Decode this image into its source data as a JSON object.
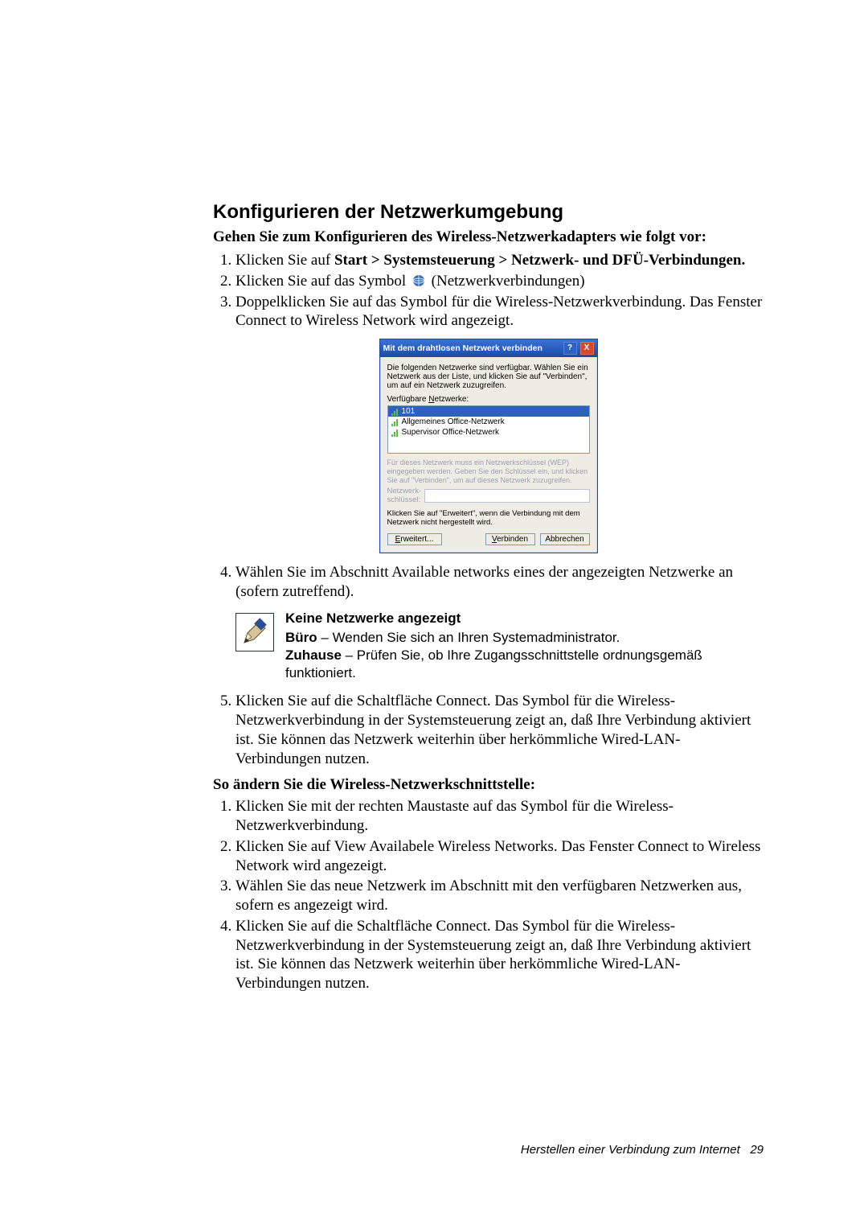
{
  "section_title": "Konfigurieren der Netzwerkumgebung",
  "intro_bold": "Gehen Sie zum Konfigurieren des Wireless-Netzwerkadapters wie folgt vor:",
  "stepsA": {
    "s1_pre": "Klicken Sie auf ",
    "s1_bold": "Start > Systemsteuerung > Netzwerk- und DFÜ-Verbindungen.",
    "s2_pre": "Klicken Sie auf das Symbol ",
    "s2_post": " (Netzwerkverbindungen)",
    "s3": "Doppelklicken Sie auf das Symbol für die Wireless-Netzwerkverbindung. Das Fenster Connect to Wireless Network wird angezeigt.",
    "s4": "Wählen Sie im Abschnitt Available networks eines der angezeigten Netzwerke an (sofern zutreffend).",
    "s5": "Klicken Sie auf die Schaltfläche Connect. Das Symbol für die Wireless-Netzwerkverbindung in der Systemsteuerung zeigt an, daß Ihre Verbindung aktiviert ist. Sie können das Netzwerk weiterhin über herkömmliche Wired-LAN-Verbindungen nutzen."
  },
  "dialog": {
    "title": "Mit dem drahtlosen Netzwerk verbinden",
    "text1": "Die folgenden Netzwerke sind verfügbar. Wählen Sie ein Netzwerk aus der Liste, und klicken Sie auf \"Verbinden\", um auf ein Netzwerk zuzugreifen.",
    "label_pre": "Verfügbare ",
    "label_ul": "N",
    "label_post": "etzwerke:",
    "net1": "101",
    "net2": "Allgemeines Office-Netzwerk",
    "net3": "Supervisor Office-Netzwerk",
    "hint": "Für dieses Netzwerk muss ein Netzwerkschlüssel (WEP) eingegeben werden. Geben Sie den Schlüssel ein, und klicken Sie auf \"Verbinden\", um auf dieses Netzwerk zuzugreifen.",
    "keylabel": "Netzwerk-schlüssel:",
    "text2": "Klicken Sie auf \"Erweitert\", wenn die Verbindung mit dem Netzwerk nicht hergestellt wird.",
    "btn_adv_ul": "E",
    "btn_adv_post": "rweitert...",
    "btn_conn_ul": "V",
    "btn_conn_post": "erbinden",
    "btn_cancel": "Abbrechen"
  },
  "note": {
    "title": "Keine Netzwerke angezeigt",
    "line1_b": "Büro",
    "line1_rest": " – Wenden Sie sich an Ihren Systemadministrator.",
    "line2_b": "Zuhause",
    "line2_rest": " – Prüfen Sie, ob Ihre Zugangsschnittstelle ordnungsgemäß funktioniert."
  },
  "subhead": "So ändern Sie die Wireless-Netzwerkschnittstelle:",
  "stepsB": {
    "s1": "Klicken Sie mit der rechten Maustaste auf das Symbol für die Wireless-Netzwerkverbindung.",
    "s2": "Klicken Sie auf View Availabele Wireless Networks. Das Fenster Connect to Wireless Network wird angezeigt.",
    "s3": "Wählen Sie das neue Netzwerk im Abschnitt mit den verfügbaren Netzwerken aus, sofern es angezeigt wird.",
    "s4": "Klicken Sie auf die Schaltfläche Connect. Das Symbol für die Wireless-Netzwerkverbindung in der Systemsteuerung zeigt an, daß Ihre Verbindung aktiviert ist. Sie können das Netzwerk weiterhin über herkömmliche Wired-LAN-Verbindungen nutzen."
  },
  "footer_text": "Herstellen einer Verbindung zum Internet",
  "footer_page": "29"
}
